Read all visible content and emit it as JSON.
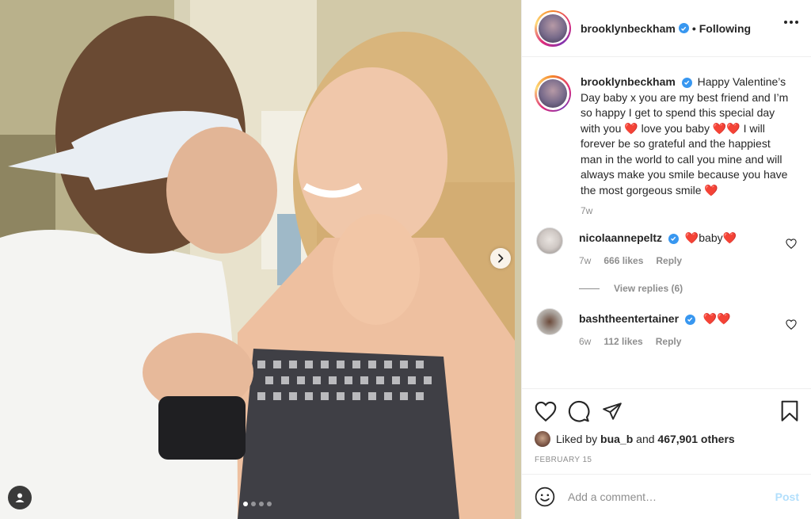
{
  "post": {
    "author": "brooklynbeckham",
    "follow_separator": "•",
    "follow_status": "Following",
    "caption_pre": "Happy Valentine’s Day baby x you are my best friend and I’m so happy I get to spend this special day with you ",
    "caption_mid1": " love you baby ",
    "caption_mid2": " I will forever be so grateful and the happiest man in the world to call you mine and will always make you smile because you have the most gorgeous smile ",
    "heart_glyph": "❤️",
    "caption_age": "7w",
    "carousel": {
      "total": 4,
      "current": 1
    }
  },
  "comments": [
    {
      "user": "nicolaannepeltz",
      "text": "baby",
      "age": "7w",
      "likes": "666 likes",
      "reply": "Reply",
      "view_replies": "View replies (6)"
    },
    {
      "user": "bashtheentertainer",
      "age": "6w",
      "likes": "112 likes",
      "reply": "Reply"
    }
  ],
  "engagement": {
    "liked_prefix": "Liked by",
    "liked_user": "bua_b",
    "liked_and": "and",
    "liked_count": "467,901 others",
    "date": "FEBRUARY 15"
  },
  "composer": {
    "placeholder": "Add a comment…",
    "post_label": "Post"
  },
  "icons": {
    "more": "more-options-icon",
    "like": "heart-icon",
    "comment": "comment-icon",
    "share": "share-icon",
    "save": "bookmark-icon",
    "emoji": "emoji-icon",
    "next": "chevron-right-icon",
    "tag": "user-tag-icon",
    "verified": "verified-badge-icon"
  },
  "colors": {
    "verified": "#3897f0",
    "heart": "#ed4956",
    "post_disabled": "#b2dffc",
    "secondary_text": "#8e8e8e"
  }
}
